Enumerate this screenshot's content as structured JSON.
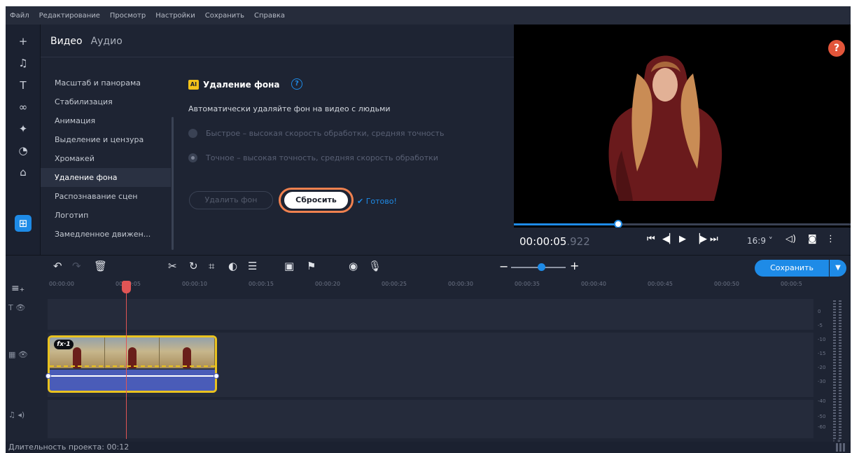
{
  "menu": [
    "Файл",
    "Редактирование",
    "Просмотр",
    "Настройки",
    "Сохранить",
    "Справка"
  ],
  "tools": [
    {
      "icon": "plus-icon",
      "glyph": "+"
    },
    {
      "icon": "music-icon",
      "glyph": "♫"
    },
    {
      "icon": "text-icon",
      "glyph": "T"
    },
    {
      "icon": "transitions-icon",
      "glyph": "∞"
    },
    {
      "icon": "effects-icon",
      "glyph": "✦"
    },
    {
      "icon": "sticker-icon",
      "glyph": "◔"
    },
    {
      "icon": "filters-icon",
      "glyph": "⌂"
    },
    {
      "icon": "more-tools-icon",
      "glyph": "⊞"
    }
  ],
  "tabs": {
    "video": "Видео",
    "audio": "Аудио"
  },
  "effects": [
    "Масштаб и панорама",
    "Стабилизация",
    "Анимация",
    "Выделение и цензура",
    "Хромакей",
    "Удаление фона",
    "Распознавание сцен",
    "Логотип",
    "Замедленное движен..."
  ],
  "selected_effect_index": 5,
  "feature": {
    "badge": "AI",
    "title": "Удаление фона",
    "help": "?",
    "description": "Автоматически удаляйте фон на видео с людьми",
    "options": [
      {
        "label": "Быстрое – высокая скорость обработки, средняя точность",
        "checked": false
      },
      {
        "label": "Точное – высокая точность, средняя скорость обработки",
        "checked": true
      }
    ],
    "remove_button": "Удалить фон",
    "reset_button": "Сбросить",
    "done_label": "✔ Готово!"
  },
  "preview": {
    "help_button": "?",
    "timecode_main": "00:00:05",
    "timecode_frac": ".922",
    "progress": 0.31,
    "aspect": "16:9 ˅"
  },
  "save_button": "Сохранить",
  "ruler_labels": [
    "00:00:00",
    "00:00:05",
    "00:00:10",
    "00:00:15",
    "00:00:20",
    "00:00:25",
    "00:00:30",
    "00:00:35",
    "00:00:40",
    "00:00:45",
    "00:00:50",
    "00:00:5"
  ],
  "clip_badge": "fx·1",
  "meter_labels": [
    "0",
    "-5",
    "-10",
    "-15",
    "-20",
    "-30",
    "-40",
    "-50",
    "-60"
  ],
  "meter_lr": "L R",
  "status": "Длительность проекта: 00:12",
  "colors": {
    "accent": "#1e8be7",
    "highlight": "#f0814f",
    "clip_border": "#e9c21f",
    "playhead": "#e05555"
  }
}
